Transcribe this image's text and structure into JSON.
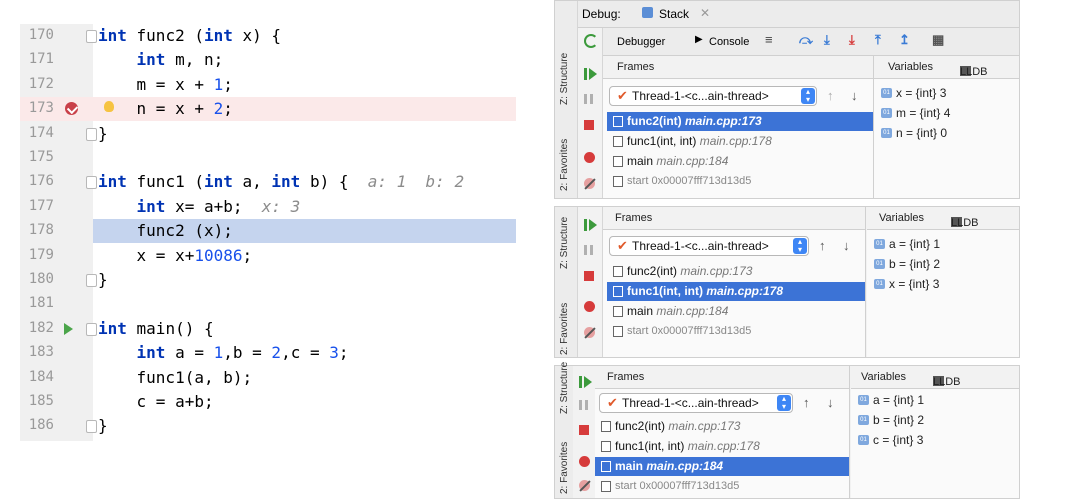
{
  "editor": {
    "lines": [
      {
        "num": "170",
        "tokens": [
          {
            "t": "int",
            "c": "kw"
          },
          {
            "t": " func2 ("
          },
          {
            "t": "int",
            "c": "kw"
          },
          {
            "t": " x) {"
          }
        ],
        "fold": true
      },
      {
        "num": "171",
        "tokens": [
          {
            "t": "    "
          },
          {
            "t": "int",
            "c": "kw"
          },
          {
            "t": " m, n;"
          }
        ]
      },
      {
        "num": "172",
        "tokens": [
          {
            "t": "    m = x + "
          },
          {
            "t": "1",
            "c": "num"
          },
          {
            "t": ";"
          }
        ]
      },
      {
        "num": "173",
        "tokens": [
          {
            "t": "    n = x + "
          },
          {
            "t": "2",
            "c": "num"
          },
          {
            "t": ";"
          }
        ],
        "highlight": "red",
        "breakpoint": true,
        "bulb": true
      },
      {
        "num": "174",
        "tokens": [
          {
            "t": "}"
          }
        ],
        "fold": true
      },
      {
        "num": "175",
        "tokens": []
      },
      {
        "num": "176",
        "tokens": [
          {
            "t": "int",
            "c": "kw"
          },
          {
            "t": " func1 ("
          },
          {
            "t": "int",
            "c": "kw"
          },
          {
            "t": " a, "
          },
          {
            "t": "int",
            "c": "kw"
          },
          {
            "t": " b) {  "
          },
          {
            "t": "a: 1  b: 2",
            "c": "hint"
          }
        ],
        "fold": true
      },
      {
        "num": "177",
        "tokens": [
          {
            "t": "    "
          },
          {
            "t": "int",
            "c": "kw"
          },
          {
            "t": " x= a+b;  "
          },
          {
            "t": "x: 3",
            "c": "hint"
          }
        ]
      },
      {
        "num": "178",
        "tokens": [
          {
            "t": "    func2 (x);"
          }
        ],
        "highlight": "blue"
      },
      {
        "num": "179",
        "tokens": [
          {
            "t": "    x = x+"
          },
          {
            "t": "10086",
            "c": "num"
          },
          {
            "t": ";"
          }
        ]
      },
      {
        "num": "180",
        "tokens": [
          {
            "t": "}"
          }
        ],
        "fold": true
      },
      {
        "num": "181",
        "tokens": []
      },
      {
        "num": "182",
        "tokens": [
          {
            "t": "int",
            "c": "kw"
          },
          {
            "t": " main() {"
          }
        ],
        "fold": true,
        "run": true
      },
      {
        "num": "183",
        "tokens": [
          {
            "t": "    "
          },
          {
            "t": "int",
            "c": "kw"
          },
          {
            "t": " a = "
          },
          {
            "t": "1",
            "c": "num"
          },
          {
            "t": ",b = "
          },
          {
            "t": "2",
            "c": "num"
          },
          {
            "t": ",c = "
          },
          {
            "t": "3",
            "c": "num"
          },
          {
            "t": ";"
          }
        ]
      },
      {
        "num": "184",
        "tokens": [
          {
            "t": "    func1(a, b);"
          }
        ]
      },
      {
        "num": "185",
        "tokens": [
          {
            "t": "    c = a+b;"
          }
        ]
      },
      {
        "num": "186",
        "tokens": [
          {
            "t": "}"
          }
        ],
        "fold": true
      }
    ]
  },
  "debug": {
    "label": "Debug:",
    "session_tab": "Stack",
    "debugger_tab": "Debugger",
    "console_tab": "Console",
    "structure_label": "Z: Structure",
    "favorites_label": "2: Favorites",
    "frames_header": "Frames",
    "variables_header": "Variables",
    "lldb_header": "LLDB",
    "thread_name": "Thread-1-<c...ain-thread>"
  },
  "panels": [
    {
      "frames": [
        {
          "fn": "func2(int)",
          "loc": "main.cpp:173",
          "sel": true
        },
        {
          "fn": "func1(int, int)",
          "loc": "main.cpp:178"
        },
        {
          "fn": "main",
          "loc": "main.cpp:184"
        },
        {
          "fn": "start 0x00007fff713d13d5",
          "loc": "",
          "dim": true
        }
      ],
      "vars": [
        "x = {int} 3",
        "m = {int} 4",
        "n = {int} 0"
      ]
    },
    {
      "frames": [
        {
          "fn": "func2(int)",
          "loc": "main.cpp:173"
        },
        {
          "fn": "func1(int, int)",
          "loc": "main.cpp:178",
          "sel": true
        },
        {
          "fn": "main",
          "loc": "main.cpp:184"
        },
        {
          "fn": "start 0x00007fff713d13d5",
          "loc": "",
          "dim": true
        }
      ],
      "vars": [
        "a = {int} 1",
        "b = {int} 2",
        "x = {int} 3"
      ]
    },
    {
      "frames": [
        {
          "fn": "func2(int)",
          "loc": "main.cpp:173"
        },
        {
          "fn": "func1(int, int)",
          "loc": "main.cpp:178"
        },
        {
          "fn": "main",
          "loc": "main.cpp:184",
          "sel": true
        },
        {
          "fn": "start 0x00007fff713d13d5",
          "loc": "",
          "dim": true
        }
      ],
      "vars": [
        "a = {int} 1",
        "b = {int} 2",
        "c = {int} 3"
      ]
    }
  ]
}
